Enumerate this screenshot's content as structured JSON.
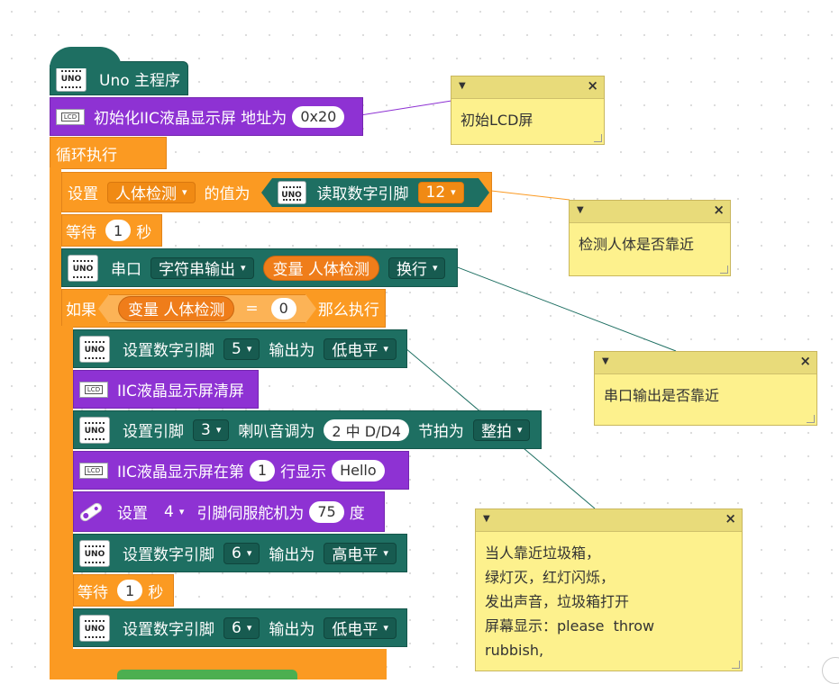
{
  "main": {
    "hat_label": "Uno 主程序",
    "loop_label": "循环执行"
  },
  "init": {
    "label": "初始化IIC液晶显示屏 地址为",
    "address": "0x20"
  },
  "set_var": {
    "prefix": "设置",
    "var_name": "人体检测",
    "middle": "的值为",
    "read_label": "读取数字引脚",
    "pin": "12"
  },
  "wait1": {
    "prefix": "等待",
    "value": "1",
    "unit": "秒"
  },
  "serial": {
    "prefix": "串口",
    "mode": "字符串输出",
    "var": "变量 人体检测",
    "newline": "换行"
  },
  "if_block": {
    "prefix": "如果",
    "var": "变量 人体检测",
    "op": "=",
    "value": "0",
    "then": "那么执行"
  },
  "dw1": {
    "label": "设置数字引脚",
    "pin": "5",
    "mid": "输出为",
    "level": "低电平"
  },
  "lcd_clear": {
    "label": "IIC液晶显示屏清屏"
  },
  "tone": {
    "prefix": "设置引脚",
    "pin": "3",
    "mid": "喇叭音调为",
    "note": "2 中 D/D4",
    "beat_label": "节拍为",
    "beat": "整拍"
  },
  "lcd_print": {
    "prefix": "IIC液晶显示屏在第",
    "row": "1",
    "mid": "行显示",
    "text": "Hello"
  },
  "servo": {
    "prefix": "设置",
    "pin": "4",
    "mid": "引脚伺服舵机为",
    "angle": "75",
    "unit": "度"
  },
  "dw2": {
    "label": "设置数字引脚",
    "pin": "6",
    "mid": "输出为",
    "level": "高电平"
  },
  "wait2": {
    "prefix": "等待",
    "value": "1",
    "unit": "秒"
  },
  "dw3": {
    "label": "设置数字引脚",
    "pin": "6",
    "mid": "输出为",
    "level": "低电平"
  },
  "board_icon_label": "UNO",
  "lcd_icon_label": "LCD",
  "comments": [
    {
      "text": "初始LCD屏"
    },
    {
      "text": "检测人体是否靠近"
    },
    {
      "text": "串口输出是否靠近"
    },
    {
      "text": "当人靠近垃圾箱，\n绿灯灭，红灯闪烁，\n发出声音，垃圾箱打开\n屏幕显示：please  throw\nrubbish,"
    }
  ],
  "colors": {
    "io_teal": "#1e6f62",
    "lcd_purple": "#8e32d3",
    "control_orange": "#fb9a22",
    "comment_yellow": "#fdf18d"
  },
  "icons": {
    "board": "uno-board-icon",
    "lcd": "lcd-icon",
    "servo": "servo-icon",
    "collapse": "collapse-triangle-icon",
    "close": "close-icon"
  }
}
